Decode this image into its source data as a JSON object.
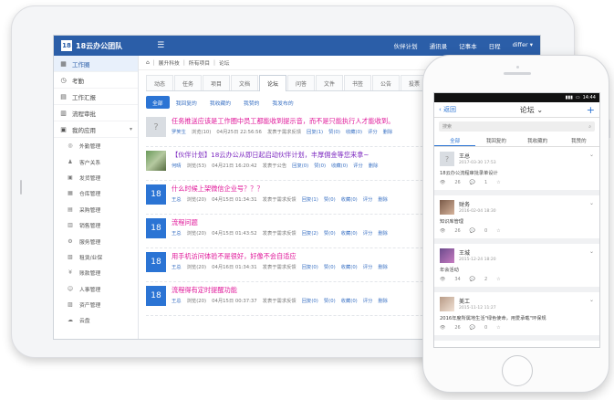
{
  "header": {
    "logo_num": "18",
    "app_name": "18云办公团队",
    "menu_icon": "menu-icon",
    "links": [
      "伙伴计划",
      "通讯录",
      "记事本",
      "日程",
      "differ ▾"
    ]
  },
  "sidebar": {
    "items": [
      {
        "label": "工作圈",
        "icon": "home-icon",
        "active": true
      },
      {
        "label": "考勤",
        "icon": "clock-icon"
      },
      {
        "label": "工作汇报",
        "icon": "report-icon"
      },
      {
        "label": "流程审批",
        "icon": "flow-icon"
      },
      {
        "label": "我的应用",
        "icon": "apps-icon",
        "chevron": "▾"
      }
    ],
    "subitems": [
      {
        "label": "外勤管理",
        "icon": "◎"
      },
      {
        "label": "客户关系",
        "icon": "♟"
      },
      {
        "label": "发货管理",
        "icon": "▣"
      },
      {
        "label": "仓库管理",
        "icon": "▦"
      },
      {
        "label": "采购管理",
        "icon": "▤"
      },
      {
        "label": "销售管理",
        "icon": "▥"
      },
      {
        "label": "服务管理",
        "icon": "⚙"
      },
      {
        "label": "租赁/业保",
        "icon": "▧"
      },
      {
        "label": "账款管理",
        "icon": "¥"
      },
      {
        "label": "人事管理",
        "icon": "☺"
      },
      {
        "label": "资产管理",
        "icon": "▨"
      },
      {
        "label": "云盘",
        "icon": "☁"
      }
    ]
  },
  "breadcrumb": {
    "home": "⌂",
    "items": [
      "展升科技",
      "所有项目",
      "论坛"
    ]
  },
  "tabs": [
    "动态",
    "任务",
    "项目",
    "文档",
    "论坛",
    "问答",
    "文件",
    "书签",
    "公告",
    "投票"
  ],
  "active_tab": "论坛",
  "filters": [
    "全部",
    "我回复的",
    "我收藏的",
    "我赞的",
    "我发布的"
  ],
  "search": {
    "placeholder": "请输入关键字",
    "icon": "search-icon"
  },
  "posts": [
    {
      "avatar": "?",
      "avatar_type": "grey",
      "title": "任务推送应该是工作圈中员工都能收到提示音，而不是只能执行人才能收到。",
      "title_color": "pink",
      "author": "罗笑生",
      "views": "浏览(10)",
      "date": "04月25日 22:56:56",
      "source": "发表于需求反馈",
      "reply": "回复(1)",
      "like": "赞(0)",
      "fav": "收藏(0)",
      "rate": "评分",
      "del": "删除"
    },
    {
      "avatar": "",
      "avatar_type": "photo",
      "title": "【伙伴计划】18云办公从即日起启动伙伴计划，丰厚佣金等您来拿~",
      "title_color": "purple",
      "author": "何晴",
      "views": "浏览(53)",
      "date": "04月21日 16:20:42",
      "source": "发表于公告",
      "reply": "回复(0)",
      "like": "赞(0)",
      "fav": "收藏(0)",
      "rate": "评分",
      "del": "删除"
    },
    {
      "avatar": "18",
      "avatar_type": "num",
      "title": "什么时候上架微信企业号？？？",
      "title_color": "pink",
      "author": "王总",
      "views": "浏览(20)",
      "date": "04月15日 01:34:31",
      "source": "发表于需求反馈",
      "reply": "回复(1)",
      "like": "赞(0)",
      "fav": "收藏(0)",
      "rate": "评分",
      "del": "删除"
    },
    {
      "avatar": "18",
      "avatar_type": "num",
      "title": "流程问题",
      "title_color": "pink",
      "author": "王总",
      "views": "浏览(20)",
      "date": "04月15日 01:43:52",
      "source": "发表于需求反馈",
      "reply": "回复(2)",
      "like": "赞(0)",
      "fav": "收藏(0)",
      "rate": "评分",
      "del": "删除"
    },
    {
      "avatar": "18",
      "avatar_type": "num",
      "title": "用手机访问体验不是很好，好像不会自适应",
      "title_color": "pink",
      "author": "王总",
      "views": "浏览(20)",
      "date": "04月16日 01:34:31",
      "source": "发表于需求反馈",
      "reply": "回复(0)",
      "like": "赞(0)",
      "fav": "收藏(0)",
      "rate": "评分",
      "del": "删除"
    },
    {
      "avatar": "18",
      "avatar_type": "num",
      "title": "流程得有定时提醒功能",
      "title_color": "pink",
      "author": "王总",
      "views": "浏览(20)",
      "date": "04月15日 00:37:37",
      "source": "发表于需求反馈",
      "reply": "回复(0)",
      "like": "赞(0)",
      "fav": "收藏(0)",
      "rate": "评分",
      "del": "删除"
    }
  ],
  "phone": {
    "status_time": "14:44",
    "back_label": "‹ 返回",
    "title": "论坛 ⌄",
    "plus": "+",
    "search_placeholder": "搜索",
    "tabs": [
      "全部",
      "我回复的",
      "我收藏的",
      "我赞的"
    ],
    "items": [
      {
        "name": "王总",
        "time": "2017-03-30 17:53",
        "body": "18云办公流程审批录单设计",
        "views": "26",
        "replies": "1",
        "avatar": "grey"
      },
      {
        "name": "财务",
        "time": "2016-02-04 18:30",
        "body": "知识库管理",
        "views": "26",
        "replies": "0",
        "avatar": "p1"
      },
      {
        "name": "王城",
        "time": "2015-12-24 18:20",
        "body": "年会活动",
        "views": "34",
        "replies": "2",
        "avatar": "p2"
      },
      {
        "name": "美工",
        "time": "2015-11-12 11:27",
        "body": "2016年度所属地生活\"绿色使命，用爱承载\"环保规",
        "views": "26",
        "replies": "0",
        "avatar": "p3"
      }
    ]
  }
}
